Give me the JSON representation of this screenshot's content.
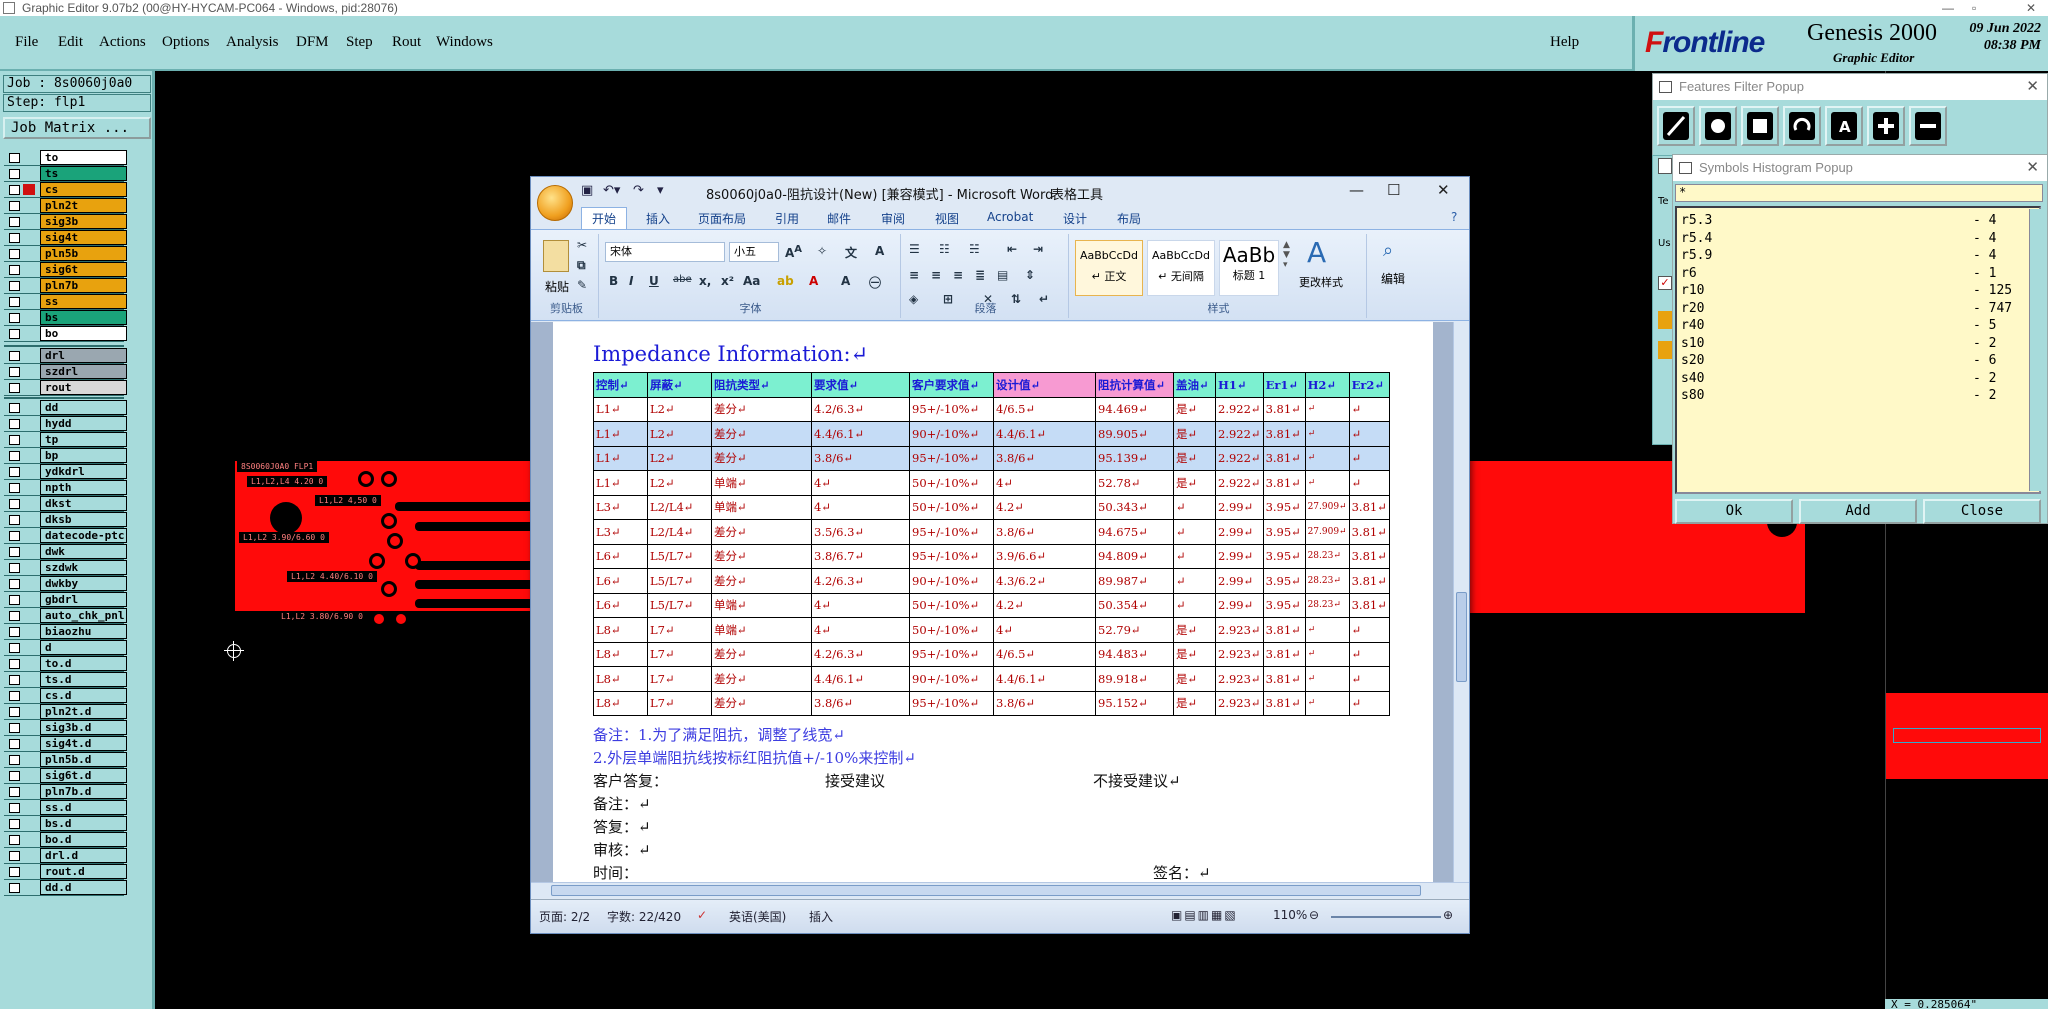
{
  "titlebar": {
    "text": "Graphic Editor 9.07b2 (00@HY-HYCAM-PC064 - Windows, pid:28076)"
  },
  "menu": {
    "items": [
      "File",
      "Edit",
      "Actions",
      "Options",
      "Analysis",
      "DFM",
      "Step",
      "Rout",
      "Windows"
    ],
    "help": "Help"
  },
  "brand": {
    "logo_f": "F",
    "logo_rest": "rontline",
    "product": "Genesis 2000",
    "subtitle": "Graphic Editor",
    "date": "09 Jun 2022",
    "time": "08:38 PM"
  },
  "job": {
    "job_label": "Job : 8s0060j0a0",
    "step_label": "Step: flp1",
    "matrix_button": "Job Matrix ..."
  },
  "layers": {
    "group1": [
      {
        "name": "to",
        "color": "#ffffff"
      },
      {
        "name": "ts",
        "color": "#1aa37a"
      },
      {
        "name": "cs",
        "color": "#e8a20e"
      },
      {
        "name": "pln2t",
        "color": "#e8a20e"
      },
      {
        "name": "sig3b",
        "color": "#e8a20e"
      },
      {
        "name": "sig4t",
        "color": "#e8a20e"
      },
      {
        "name": "pln5b",
        "color": "#e8a20e"
      },
      {
        "name": "sig6t",
        "color": "#e8a20e"
      },
      {
        "name": "pln7b",
        "color": "#e8a20e"
      },
      {
        "name": "ss",
        "color": "#e8a20e"
      },
      {
        "name": "bs",
        "color": "#1aa37a"
      },
      {
        "name": "bo",
        "color": "#ffffff"
      }
    ],
    "group2": [
      {
        "name": "drl",
        "color": "#9aa7b0"
      },
      {
        "name": "szdrl",
        "color": "#9aa7b0"
      },
      {
        "name": "rout",
        "color": "#d8d8d8"
      }
    ],
    "group3": [
      {
        "name": "dd"
      },
      {
        "name": "hydd"
      },
      {
        "name": "tp"
      },
      {
        "name": "bp"
      },
      {
        "name": "ydkdrl"
      },
      {
        "name": "npth"
      },
      {
        "name": "dkst"
      },
      {
        "name": "dksb"
      },
      {
        "name": "datecode-ptc"
      },
      {
        "name": "dwk"
      },
      {
        "name": "szdwk"
      },
      {
        "name": "dwkby"
      },
      {
        "name": "gbdrl"
      },
      {
        "name": "auto_chk_pnl"
      },
      {
        "name": "biaozhu"
      },
      {
        "name": "d"
      },
      {
        "name": "to.d"
      },
      {
        "name": "ts.d"
      },
      {
        "name": "cs.d"
      },
      {
        "name": "pln2t.d"
      },
      {
        "name": "sig3b.d"
      },
      {
        "name": "sig4t.d"
      },
      {
        "name": "pln5b.d"
      },
      {
        "name": "sig6t.d"
      },
      {
        "name": "pln7b.d"
      },
      {
        "name": "ss.d"
      },
      {
        "name": "bs.d"
      },
      {
        "name": "bo.d"
      },
      {
        "name": "drl.d"
      },
      {
        "name": "rout.d"
      },
      {
        "name": "dd.d"
      }
    ]
  },
  "pcb_labels": [
    "8S0060J0A0 FLP1",
    "L1,L2,L4 4.20 0",
    "L1,L2 4,50 0",
    "L1,L2 3.90/6.60 0",
    "L1,L2 4.40/6.10 0",
    "L1,L2 3.80/6.90 0"
  ],
  "features_popup": {
    "title": "Features Filter Popup"
  },
  "symbols_popup": {
    "title": "Symbols Histogram Popup",
    "filter": "*",
    "rows": [
      {
        "sym": "r5.3",
        "count": "- 4"
      },
      {
        "sym": "r5.4",
        "count": "- 4"
      },
      {
        "sym": "r5.9",
        "count": "- 4"
      },
      {
        "sym": "r6",
        "count": "- 1"
      },
      {
        "sym": "r10",
        "count": "- 125"
      },
      {
        "sym": "r20",
        "count": "- 747"
      },
      {
        "sym": "r40",
        "count": "- 5"
      },
      {
        "sym": "s10",
        "count": "- 2"
      },
      {
        "sym": "s20",
        "count": "- 6"
      },
      {
        "sym": "s40",
        "count": "- 2"
      },
      {
        "sym": "s80",
        "count": "- 2"
      }
    ],
    "ok": "Ok",
    "add": "Add",
    "close": "Close"
  },
  "status_coord": "X = 0.285064\"",
  "word": {
    "title": "8s0060j0a0-阻抗设计(New) [兼容模式] - Microsoft Word",
    "tools_title": "表格工具",
    "tabs": [
      "开始",
      "插入",
      "页面布局",
      "引用",
      "邮件",
      "审阅",
      "视图",
      "Acrobat",
      "设计",
      "布局"
    ],
    "ribbon": {
      "paste": "粘贴",
      "clipboard": "剪贴板",
      "font_name": "宋体",
      "font_size": "小五",
      "font_group": "字体",
      "para_group": "段落",
      "style_group": "样式",
      "styles": [
        {
          "sample": "AaBbCcDd",
          "name": "↵ 正文"
        },
        {
          "sample": "AaBbCcDd",
          "name": "↵ 无间隔"
        },
        {
          "sample": "AaBb",
          "name": "标题 1"
        }
      ],
      "change_styles": "更改样式",
      "edit": "编辑"
    },
    "doc": {
      "heading": "Impedance Information:↵",
      "headers": [
        "控制↵",
        "屏蔽↵",
        "阻抗类型↵",
        "要求值↵",
        "客户要求值↵",
        "设计值↵",
        "阻抗计算值↵",
        "盖油↵",
        "H1↵",
        "Er1↵",
        "H2↵",
        "Er2↵"
      ],
      "rows": [
        [
          "L1↵",
          "L2↵",
          "差分↵",
          "4.2/6.3↵",
          "95+/-10%↵",
          "4/6.5↵",
          "94.469↵",
          "是↵",
          "2.922↵",
          "3.81↵",
          "↵",
          "↵"
        ],
        [
          "L1↵",
          "L2↵",
          "差分↵",
          "4.4/6.1↵",
          "90+/-10%↵",
          "4.4/6.1↵",
          "89.905↵",
          "是↵",
          "2.922↵",
          "3.81↵",
          "↵",
          "↵"
        ],
        [
          "L1↵",
          "L2↵",
          "差分↵",
          "3.8/6↵",
          "95+/-10%↵",
          "3.8/6↵",
          "95.139↵",
          "是↵",
          "2.922↵",
          "3.81↵",
          "↵",
          "↵"
        ],
        [
          "L1↵",
          "L2↵",
          "单端↵",
          "4↵",
          "50+/-10%↵",
          "4↵",
          "52.78↵",
          "是↵",
          "2.922↵",
          "3.81↵",
          "↵",
          "↵"
        ],
        [
          "L3↵",
          "L2/L4↵",
          "单端↵",
          "4↵",
          "50+/-10%↵",
          "4.2↵",
          "50.343↵",
          "↵",
          "2.99↵",
          "3.95↵",
          "27.909↵",
          "3.81↵"
        ],
        [
          "L3↵",
          "L2/L4↵",
          "差分↵",
          "3.5/6.3↵",
          "95+/-10%↵",
          "3.8/6↵",
          "94.675↵",
          "↵",
          "2.99↵",
          "3.95↵",
          "27.909↵",
          "3.81↵"
        ],
        [
          "L6↵",
          "L5/L7↵",
          "差分↵",
          "3.8/6.7↵",
          "95+/-10%↵",
          "3.9/6.6↵",
          "94.809↵",
          "↵",
          "2.99↵",
          "3.95↵",
          "28.23↵",
          "3.81↵"
        ],
        [
          "L6↵",
          "L5/L7↵",
          "差分↵",
          "4.2/6.3↵",
          "90+/-10%↵",
          "4.3/6.2↵",
          "89.987↵",
          "↵",
          "2.99↵",
          "3.95↵",
          "28.23↵",
          "3.81↵"
        ],
        [
          "L6↵",
          "L5/L7↵",
          "单端↵",
          "4↵",
          "50+/-10%↵",
          "4.2↵",
          "50.354↵",
          "↵",
          "2.99↵",
          "3.95↵",
          "28.23↵",
          "3.81↵"
        ],
        [
          "L8↵",
          "L7↵",
          "单端↵",
          "4↵",
          "50+/-10%↵",
          "4↵",
          "52.79↵",
          "是↵",
          "2.923↵",
          "3.81↵",
          "↵",
          "↵"
        ],
        [
          "L8↵",
          "L7↵",
          "差分↵",
          "4.2/6.3↵",
          "95+/-10%↵",
          "4/6.5↵",
          "94.483↵",
          "是↵",
          "2.923↵",
          "3.81↵",
          "↵",
          "↵"
        ],
        [
          "L8↵",
          "L7↵",
          "差分↵",
          "4.4/6.1↵",
          "90+/-10%↵",
          "4.4/6.1↵",
          "89.918↵",
          "是↵",
          "2.923↵",
          "3.81↵",
          "↵",
          "↵"
        ],
        [
          "L8↵",
          "L7↵",
          "差分↵",
          "3.8/6↵",
          "95+/-10%↵",
          "3.8/6↵",
          "95.152↵",
          "是↵",
          "2.923↵",
          "3.81↵",
          "↵",
          "↵"
        ]
      ],
      "note1": "备注：1.为了满足阻抗，调整了线宽↵",
      "note2": "2.外层单端阻抗线按标红阻抗值+/-10%来控制↵",
      "reply_label": "客户答复：",
      "accept": "接受建议",
      "reject": "不接受建议↵",
      "remark": "备注：↵",
      "answer": "答复：↵",
      "review": "审核：↵",
      "time": "时间：",
      "sign": "签名：↵"
    },
    "status": {
      "page": "页面: 2/2",
      "words": "字数: 22/420",
      "lang": "英语(美国)",
      "mode": "插入",
      "zoom": "110%"
    }
  }
}
